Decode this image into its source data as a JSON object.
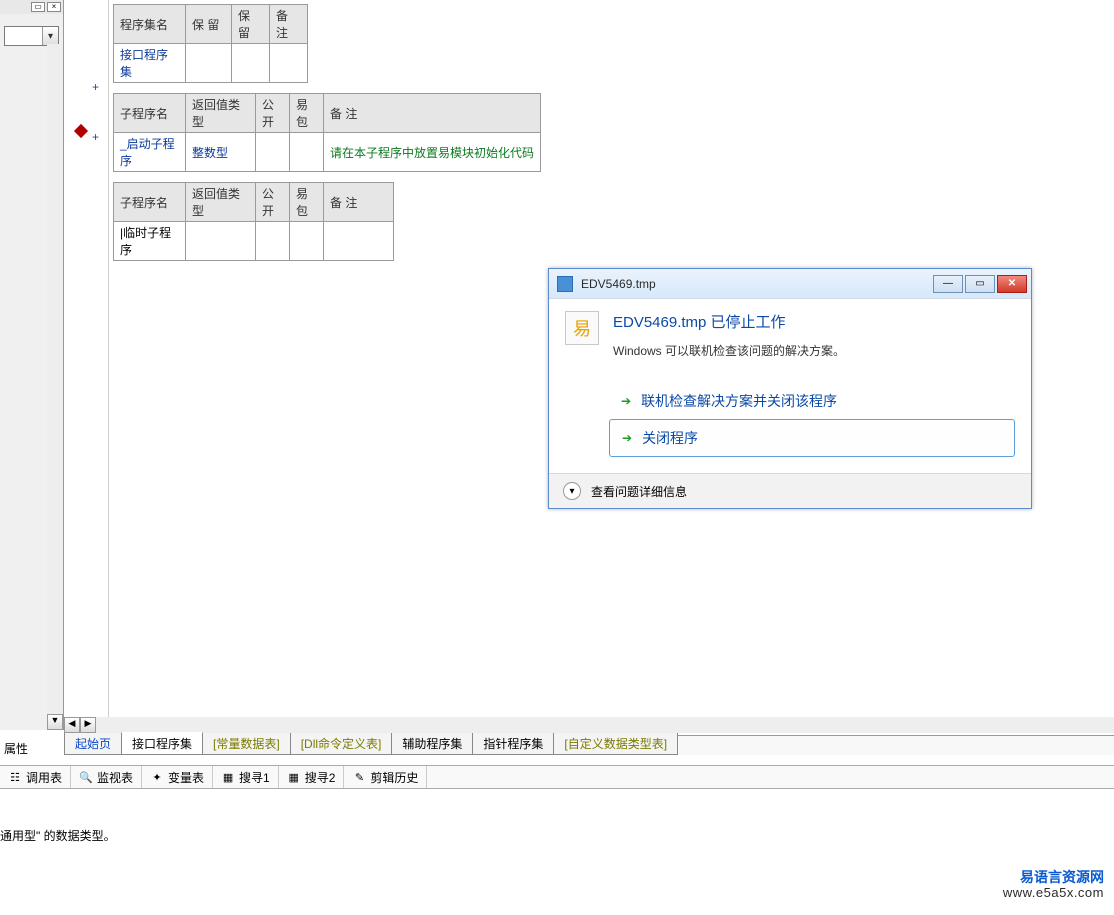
{
  "left_panel": {
    "prop_label": "属性"
  },
  "tables": {
    "t1": {
      "headers": [
        "程序集名",
        "保 留",
        "保 留",
        "备 注"
      ],
      "row": [
        "接口程序集",
        "",
        "",
        ""
      ]
    },
    "t2": {
      "headers": [
        "子程序名",
        "返回值类型",
        "公开",
        "易包",
        "备 注"
      ],
      "row": [
        "_启动子程序",
        "整数型",
        "",
        "",
        "请在本子程序中放置易模块初始化代码"
      ]
    },
    "t3": {
      "headers": [
        "子程序名",
        "返回值类型",
        "公开",
        "易包",
        "备 注"
      ],
      "row": [
        "|临时子程序",
        "",
        "",
        "",
        ""
      ]
    }
  },
  "tabs": [
    {
      "label": "起始页",
      "style": "blue"
    },
    {
      "label": "接口程序集",
      "style": "active"
    },
    {
      "label": "[常量数据表]",
      "style": "olive"
    },
    {
      "label": "[Dll命令定义表]",
      "style": "olive"
    },
    {
      "label": "辅助程序集",
      "style": ""
    },
    {
      "label": "指针程序集",
      "style": ""
    },
    {
      "label": "[自定义数据类型表]",
      "style": "olive"
    }
  ],
  "toolbar": [
    {
      "icon": "☷",
      "label": "调用表"
    },
    {
      "icon": "🔍",
      "label": "监视表"
    },
    {
      "icon": "✦",
      "label": "变量表"
    },
    {
      "icon": "▦",
      "label": "搜寻1"
    },
    {
      "icon": "▦",
      "label": "搜寻2"
    },
    {
      "icon": "✎",
      "label": "剪辑历史"
    }
  ],
  "output_text": "通用型\" 的数据类型。",
  "watermark": {
    "cn": "易语言资源网",
    "url": "www.e5a5x.com"
  },
  "dialog": {
    "title": "EDV5469.tmp",
    "heading": "EDV5469.tmp 已停止工作",
    "subtext": "Windows 可以联机检查该问题的解决方案。",
    "action1": "联机检查解决方案并关闭该程序",
    "action2": "关闭程序",
    "details": "查看问题详细信息",
    "icon_char": "易"
  }
}
